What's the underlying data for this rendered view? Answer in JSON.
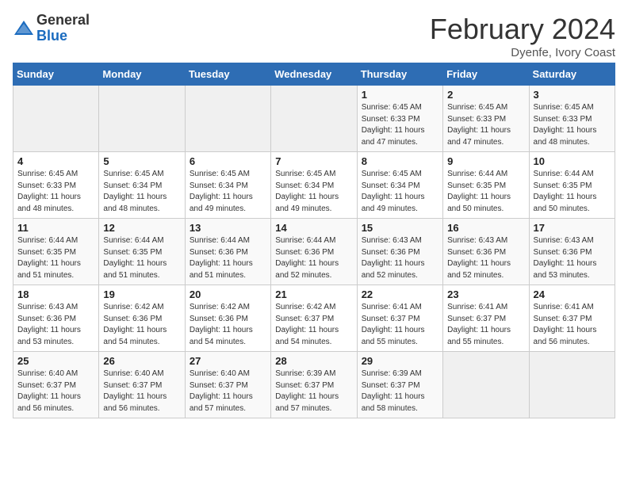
{
  "logo": {
    "general": "General",
    "blue": "Blue"
  },
  "title": "February 2024",
  "subtitle": "Dyenfe, Ivory Coast",
  "days_of_week": [
    "Sunday",
    "Monday",
    "Tuesday",
    "Wednesday",
    "Thursday",
    "Friday",
    "Saturday"
  ],
  "weeks": [
    [
      {
        "day": "",
        "info": ""
      },
      {
        "day": "",
        "info": ""
      },
      {
        "day": "",
        "info": ""
      },
      {
        "day": "",
        "info": ""
      },
      {
        "day": "1",
        "info": "Sunrise: 6:45 AM\nSunset: 6:33 PM\nDaylight: 11 hours and 47 minutes."
      },
      {
        "day": "2",
        "info": "Sunrise: 6:45 AM\nSunset: 6:33 PM\nDaylight: 11 hours and 47 minutes."
      },
      {
        "day": "3",
        "info": "Sunrise: 6:45 AM\nSunset: 6:33 PM\nDaylight: 11 hours and 48 minutes."
      }
    ],
    [
      {
        "day": "4",
        "info": "Sunrise: 6:45 AM\nSunset: 6:33 PM\nDaylight: 11 hours and 48 minutes."
      },
      {
        "day": "5",
        "info": "Sunrise: 6:45 AM\nSunset: 6:34 PM\nDaylight: 11 hours and 48 minutes."
      },
      {
        "day": "6",
        "info": "Sunrise: 6:45 AM\nSunset: 6:34 PM\nDaylight: 11 hours and 49 minutes."
      },
      {
        "day": "7",
        "info": "Sunrise: 6:45 AM\nSunset: 6:34 PM\nDaylight: 11 hours and 49 minutes."
      },
      {
        "day": "8",
        "info": "Sunrise: 6:45 AM\nSunset: 6:34 PM\nDaylight: 11 hours and 49 minutes."
      },
      {
        "day": "9",
        "info": "Sunrise: 6:44 AM\nSunset: 6:35 PM\nDaylight: 11 hours and 50 minutes."
      },
      {
        "day": "10",
        "info": "Sunrise: 6:44 AM\nSunset: 6:35 PM\nDaylight: 11 hours and 50 minutes."
      }
    ],
    [
      {
        "day": "11",
        "info": "Sunrise: 6:44 AM\nSunset: 6:35 PM\nDaylight: 11 hours and 51 minutes."
      },
      {
        "day": "12",
        "info": "Sunrise: 6:44 AM\nSunset: 6:35 PM\nDaylight: 11 hours and 51 minutes."
      },
      {
        "day": "13",
        "info": "Sunrise: 6:44 AM\nSunset: 6:36 PM\nDaylight: 11 hours and 51 minutes."
      },
      {
        "day": "14",
        "info": "Sunrise: 6:44 AM\nSunset: 6:36 PM\nDaylight: 11 hours and 52 minutes."
      },
      {
        "day": "15",
        "info": "Sunrise: 6:43 AM\nSunset: 6:36 PM\nDaylight: 11 hours and 52 minutes."
      },
      {
        "day": "16",
        "info": "Sunrise: 6:43 AM\nSunset: 6:36 PM\nDaylight: 11 hours and 52 minutes."
      },
      {
        "day": "17",
        "info": "Sunrise: 6:43 AM\nSunset: 6:36 PM\nDaylight: 11 hours and 53 minutes."
      }
    ],
    [
      {
        "day": "18",
        "info": "Sunrise: 6:43 AM\nSunset: 6:36 PM\nDaylight: 11 hours and 53 minutes."
      },
      {
        "day": "19",
        "info": "Sunrise: 6:42 AM\nSunset: 6:36 PM\nDaylight: 11 hours and 54 minutes."
      },
      {
        "day": "20",
        "info": "Sunrise: 6:42 AM\nSunset: 6:36 PM\nDaylight: 11 hours and 54 minutes."
      },
      {
        "day": "21",
        "info": "Sunrise: 6:42 AM\nSunset: 6:37 PM\nDaylight: 11 hours and 54 minutes."
      },
      {
        "day": "22",
        "info": "Sunrise: 6:41 AM\nSunset: 6:37 PM\nDaylight: 11 hours and 55 minutes."
      },
      {
        "day": "23",
        "info": "Sunrise: 6:41 AM\nSunset: 6:37 PM\nDaylight: 11 hours and 55 minutes."
      },
      {
        "day": "24",
        "info": "Sunrise: 6:41 AM\nSunset: 6:37 PM\nDaylight: 11 hours and 56 minutes."
      }
    ],
    [
      {
        "day": "25",
        "info": "Sunrise: 6:40 AM\nSunset: 6:37 PM\nDaylight: 11 hours and 56 minutes."
      },
      {
        "day": "26",
        "info": "Sunrise: 6:40 AM\nSunset: 6:37 PM\nDaylight: 11 hours and 56 minutes."
      },
      {
        "day": "27",
        "info": "Sunrise: 6:40 AM\nSunset: 6:37 PM\nDaylight: 11 hours and 57 minutes."
      },
      {
        "day": "28",
        "info": "Sunrise: 6:39 AM\nSunset: 6:37 PM\nDaylight: 11 hours and 57 minutes."
      },
      {
        "day": "29",
        "info": "Sunrise: 6:39 AM\nSunset: 6:37 PM\nDaylight: 11 hours and 58 minutes."
      },
      {
        "day": "",
        "info": ""
      },
      {
        "day": "",
        "info": ""
      }
    ]
  ]
}
